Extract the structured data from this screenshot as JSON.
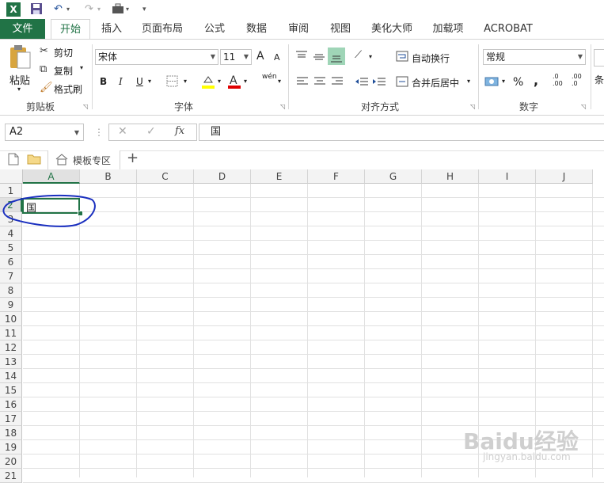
{
  "app": {
    "logo_text": "X",
    "qat_undo": "↶",
    "qat_redo": "↷"
  },
  "tabs": [
    {
      "label": "文件"
    },
    {
      "label": "开始"
    },
    {
      "label": "插入"
    },
    {
      "label": "页面布局"
    },
    {
      "label": "公式"
    },
    {
      "label": "数据"
    },
    {
      "label": "审阅"
    },
    {
      "label": "视图"
    },
    {
      "label": "美化大师"
    },
    {
      "label": "加载项"
    },
    {
      "label": "ACROBAT"
    }
  ],
  "clipboard": {
    "paste": "粘贴",
    "cut": "剪切",
    "copy": "复制",
    "format_painter": "格式刷",
    "group": "剪贴板"
  },
  "font": {
    "name": "宋体",
    "size": "11",
    "grow": "A",
    "shrink": "A",
    "bold": "B",
    "italic": "I",
    "underline": "U",
    "phonetic": "wén",
    "group": "字体"
  },
  "alignment": {
    "wrap": "自动换行",
    "merge": "合并后居中",
    "group": "对齐方式"
  },
  "number": {
    "format": "常规",
    "percent": "%",
    "comma": ",",
    "inc_dec": ".0",
    "dec_dec": ".00",
    "group": "数字"
  },
  "styles_partial": "条",
  "formula_bar": {
    "cell_ref": "A2",
    "cancel": "✕",
    "enter": "✓",
    "fx": "fx",
    "value": "国"
  },
  "doc_tabs": {
    "template_tab": "模板专区",
    "add": "+"
  },
  "grid": {
    "columns": [
      "A",
      "B",
      "C",
      "D",
      "E",
      "F",
      "G",
      "H",
      "I",
      "J"
    ],
    "rows": [
      "1",
      "2",
      "3",
      "4",
      "5",
      "6",
      "7",
      "8",
      "9",
      "10",
      "11",
      "12",
      "13",
      "14",
      "15",
      "16",
      "17",
      "18",
      "19",
      "20",
      "21"
    ],
    "active_cell": "A2",
    "cell_values": {
      "A2": "国"
    }
  },
  "colors": {
    "accent": "#217346",
    "annotation": "#1a2fbf",
    "paste_icon": "#d8a53f"
  },
  "watermark": {
    "line1": "Baidu经验",
    "line2": "jingyan.baidu.com"
  }
}
